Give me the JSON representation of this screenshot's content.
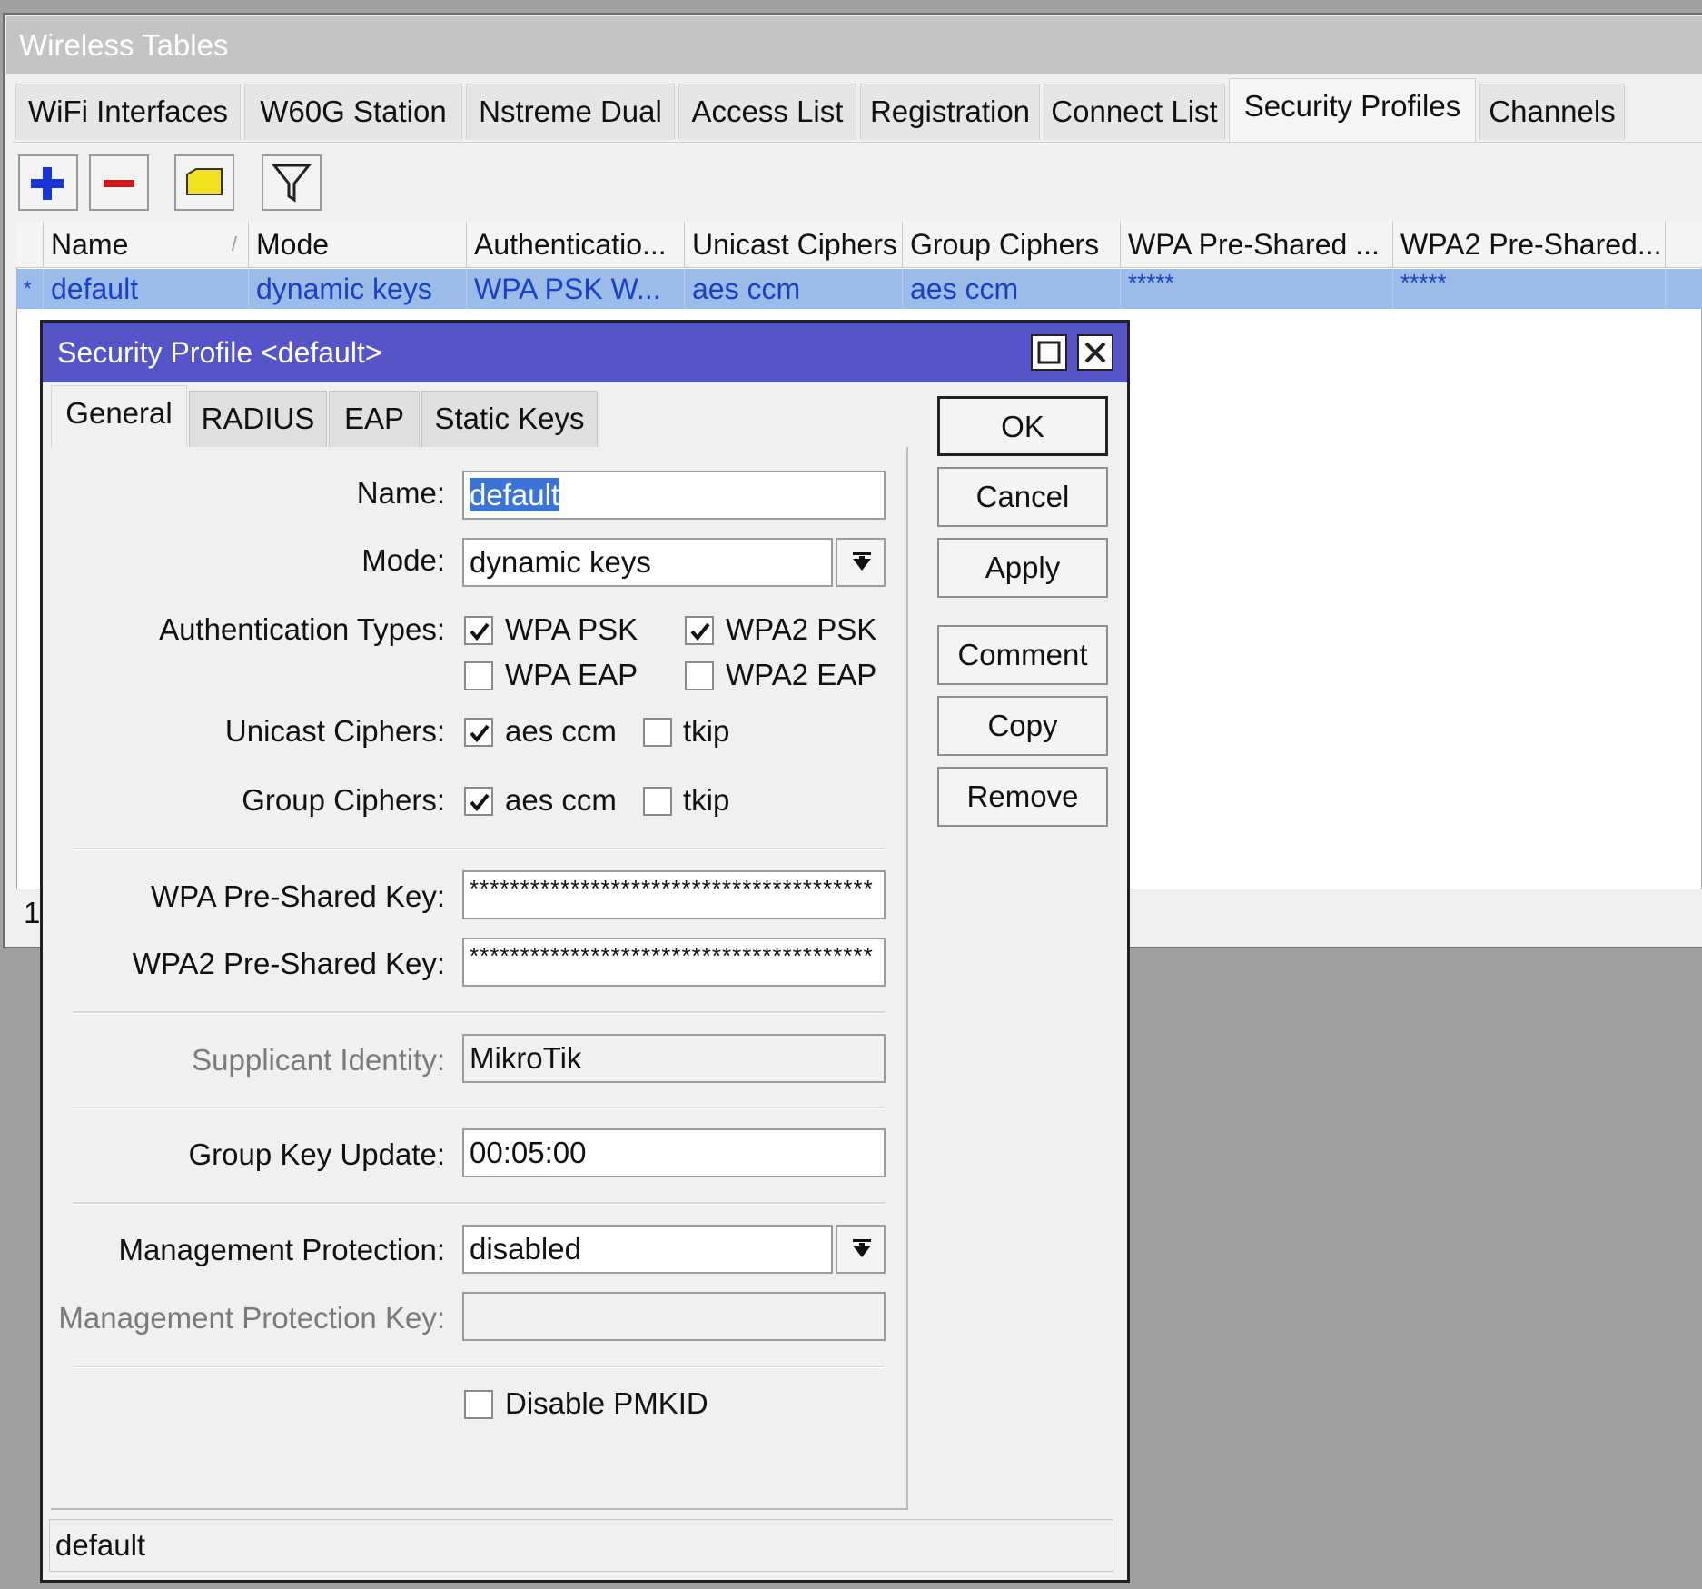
{
  "main_window": {
    "title": "Wireless Tables",
    "tabs": [
      "WiFi Interfaces",
      "W60G Station",
      "Nstreme Dual",
      "Access List",
      "Registration",
      "Connect List",
      "Security Profiles",
      "Channels"
    ],
    "active_tab": "Security Profiles",
    "toolbar": {
      "add_icon": "plus-icon",
      "remove_icon": "minus-icon",
      "comment_icon": "note-icon",
      "filter_icon": "filter-icon"
    },
    "table": {
      "columns": [
        "Name",
        "Mode",
        "Authenticatio...",
        "Unicast Ciphers",
        "Group Ciphers",
        "WPA Pre-Shared ...",
        "WPA2 Pre-Shared..."
      ],
      "sort_indicator": "/",
      "rows": [
        {
          "marker": "*",
          "name": "default",
          "mode": "dynamic keys",
          "authentication": "WPA PSK W...",
          "unicast_ciphers": "aes ccm",
          "group_ciphers": "aes ccm",
          "wpa_psk": "*****",
          "wpa2_psk": "*****"
        }
      ]
    },
    "status_count": "1"
  },
  "dialog": {
    "title": "Security Profile <default>",
    "tabs": [
      "General",
      "RADIUS",
      "EAP",
      "Static Keys"
    ],
    "active_tab": "General",
    "fields": {
      "name_label": "Name:",
      "name_value": "default",
      "mode_label": "Mode:",
      "mode_value": "dynamic keys",
      "auth_label": "Authentication Types:",
      "auth_options": [
        {
          "label": "WPA PSK",
          "checked": true
        },
        {
          "label": "WPA2 PSK",
          "checked": true
        },
        {
          "label": "WPA EAP",
          "checked": false
        },
        {
          "label": "WPA2 EAP",
          "checked": false
        }
      ],
      "unicast_label": "Unicast Ciphers:",
      "unicast_options": [
        {
          "label": "aes ccm",
          "checked": true
        },
        {
          "label": "tkip",
          "checked": false
        }
      ],
      "group_label": "Group Ciphers:",
      "group_options": [
        {
          "label": "aes ccm",
          "checked": true
        },
        {
          "label": "tkip",
          "checked": false
        }
      ],
      "wpa_psk_label": "WPA Pre-Shared Key:",
      "wpa_psk_value": "****************************************",
      "wpa2_psk_label": "WPA2 Pre-Shared Key:",
      "wpa2_psk_value": "****************************************",
      "supplicant_label": "Supplicant Identity:",
      "supplicant_value": "MikroTik",
      "group_key_update_label": "Group Key Update:",
      "group_key_update_value": "00:05:00",
      "mgmt_protection_label": "Management Protection:",
      "mgmt_protection_value": "disabled",
      "mgmt_protection_key_label": "Management Protection Key:",
      "mgmt_protection_key_value": "",
      "disable_pmkid_label": "Disable PMKID",
      "disable_pmkid_checked": false
    },
    "buttons": [
      "OK",
      "Cancel",
      "Apply",
      "Comment",
      "Copy",
      "Remove"
    ],
    "status_text": "default"
  },
  "colors": {
    "dialog_title_bar": "#5554c8",
    "selected_row": "#9bbbe8",
    "row_text": "#1a3fc8",
    "selection": "#3a74d6"
  }
}
